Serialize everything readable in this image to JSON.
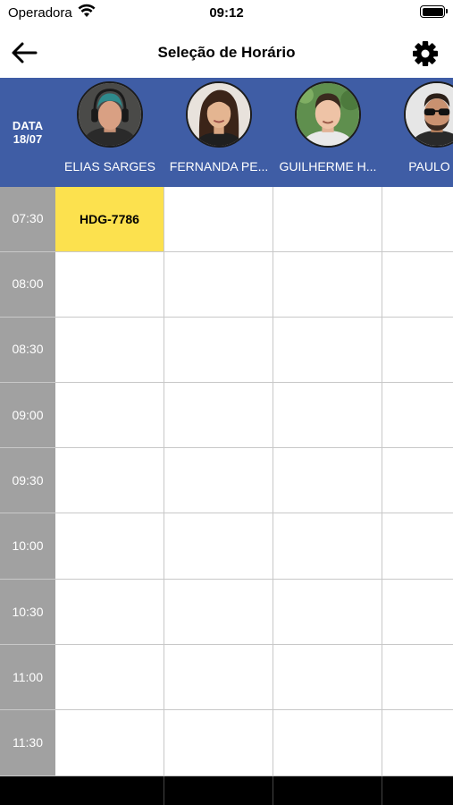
{
  "status_bar": {
    "carrier": "Operadora",
    "time": "09:12"
  },
  "nav": {
    "title": "Seleção de Horário",
    "back_icon": "arrow-left-icon",
    "settings_icon": "gear-icon"
  },
  "header": {
    "date_label": "DATA",
    "date_value": "18/07"
  },
  "barbers": [
    {
      "name": "ELIAS SARGES"
    },
    {
      "name": "FERNANDA PE..."
    },
    {
      "name": "GUILHERME H..."
    },
    {
      "name": "PAULO VI"
    }
  ],
  "times": [
    "07:30",
    "08:00",
    "08:30",
    "09:00",
    "09:30",
    "10:00",
    "10:30",
    "11:00",
    "11:30"
  ],
  "bookings": [
    {
      "time": "07:30",
      "barber": "ELIAS SARGES",
      "label": "HDG-7786"
    }
  ],
  "colors": {
    "header_bg": "#3f5da5",
    "time_col_bg": "#a1a1a1",
    "booked_bg": "#fce14e"
  }
}
